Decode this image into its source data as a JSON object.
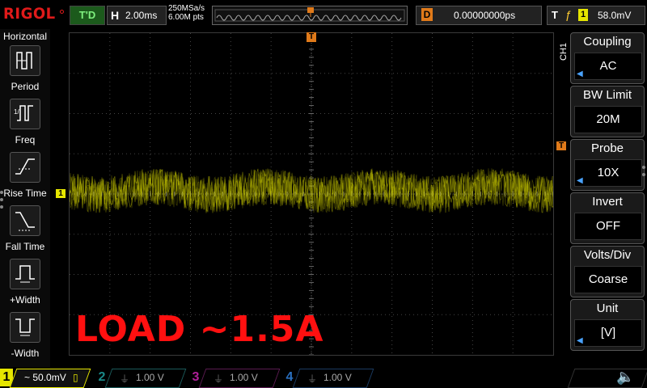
{
  "top": {
    "logo": "RIGOL",
    "run_status": "T'D",
    "horizontal_label": "H",
    "timebase": "2.00ms",
    "sample_rate": "250MSa/s",
    "memory_depth": "6.00M pts",
    "delay_label": "D",
    "delay_value": "0.00000000ps",
    "trigger_label": "T",
    "trigger_source": "1",
    "trigger_level": "58.0mV"
  },
  "left_menu": {
    "title": "Horizontal",
    "items": [
      {
        "label": "Period",
        "icon": "period-icon"
      },
      {
        "label": "Freq",
        "icon": "frequency-icon"
      },
      {
        "label": "Rise Time",
        "icon": "rise-time-icon"
      },
      {
        "label": "Fall Time",
        "icon": "fall-time-icon"
      },
      {
        "label": "+Width",
        "icon": "positive-width-icon"
      },
      {
        "label": "-Width",
        "icon": "negative-width-icon"
      }
    ]
  },
  "screen": {
    "ch1_marker": "1",
    "trigger_marker": "T",
    "overlay_text": "LOAD ~1.5A",
    "trace_color": "#d8d800"
  },
  "right_menu": {
    "channel_tag": "CH1",
    "items": [
      {
        "title": "Coupling",
        "value": "AC"
      },
      {
        "title": "BW Limit",
        "value": "20M"
      },
      {
        "title": "Probe",
        "value": "10X"
      },
      {
        "title": "Invert",
        "value": "OFF"
      },
      {
        "title": "Volts/Div",
        "value": "Coarse"
      },
      {
        "title": "Unit",
        "value": "[V]"
      }
    ]
  },
  "bottom": {
    "ch1": {
      "num": "1",
      "text": "~ 50.0mV",
      "color": "#e6e600"
    },
    "ch2": {
      "num": "2",
      "text": "1.00 V",
      "color": "#1a8a8a"
    },
    "ch3": {
      "num": "3",
      "text": "1.00 V",
      "color": "#b0209a"
    },
    "ch4": {
      "num": "4",
      "text": "1.00 V",
      "color": "#1a5aa0"
    }
  }
}
